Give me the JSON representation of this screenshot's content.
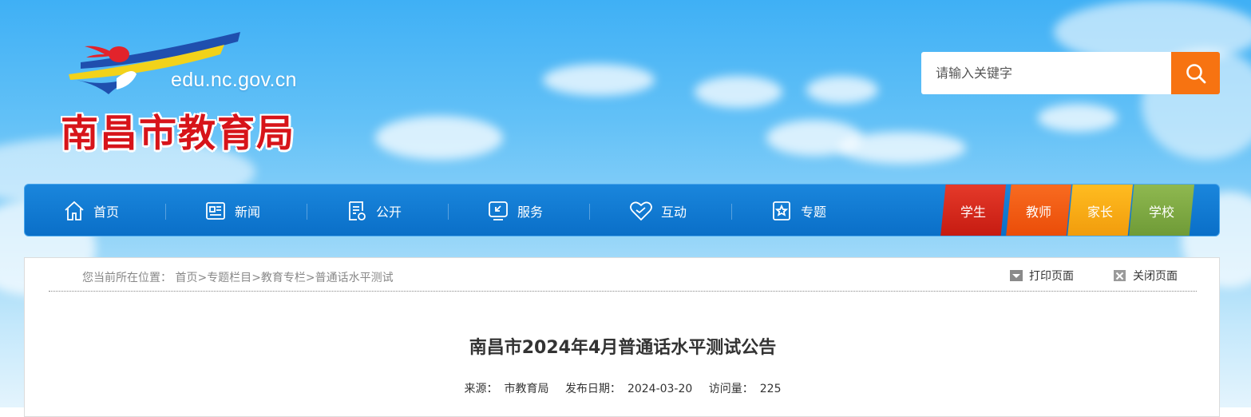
{
  "header": {
    "logo_domain": "edu.nc.gov.cn",
    "logo_name": "南昌市教育局"
  },
  "search": {
    "placeholder": "请输入关键字",
    "icon": "search-icon"
  },
  "nav": {
    "items": [
      {
        "label": "首页",
        "icon": "home-icon"
      },
      {
        "label": "新闻",
        "icon": "newspaper-icon"
      },
      {
        "label": "公开",
        "icon": "document-icon"
      },
      {
        "label": "服务",
        "icon": "service-icon"
      },
      {
        "label": "互动",
        "icon": "heart-icon"
      },
      {
        "label": "专题",
        "icon": "topic-icon"
      }
    ],
    "roles": [
      {
        "label": "学生",
        "color": "#d21f14"
      },
      {
        "label": "教师",
        "color": "#f0530f"
      },
      {
        "label": "家长",
        "color": "#f5a510"
      },
      {
        "label": "学校",
        "color": "#7aa540"
      }
    ]
  },
  "breadcrumb": {
    "prefix": "您当前所在位置：",
    "items": [
      "首页",
      "专题栏目",
      "教育专栏",
      "普通话水平测试"
    ],
    "separator": ">"
  },
  "tools": {
    "print": "打印页面",
    "close": "关闭页面"
  },
  "article": {
    "title": "南昌市2024年4月普通话水平测试公告",
    "source_label": "来源：",
    "source": "市教育局",
    "date_label": "发布日期：",
    "date": "2024-03-20",
    "views_label": "访问量：",
    "views": "225"
  }
}
